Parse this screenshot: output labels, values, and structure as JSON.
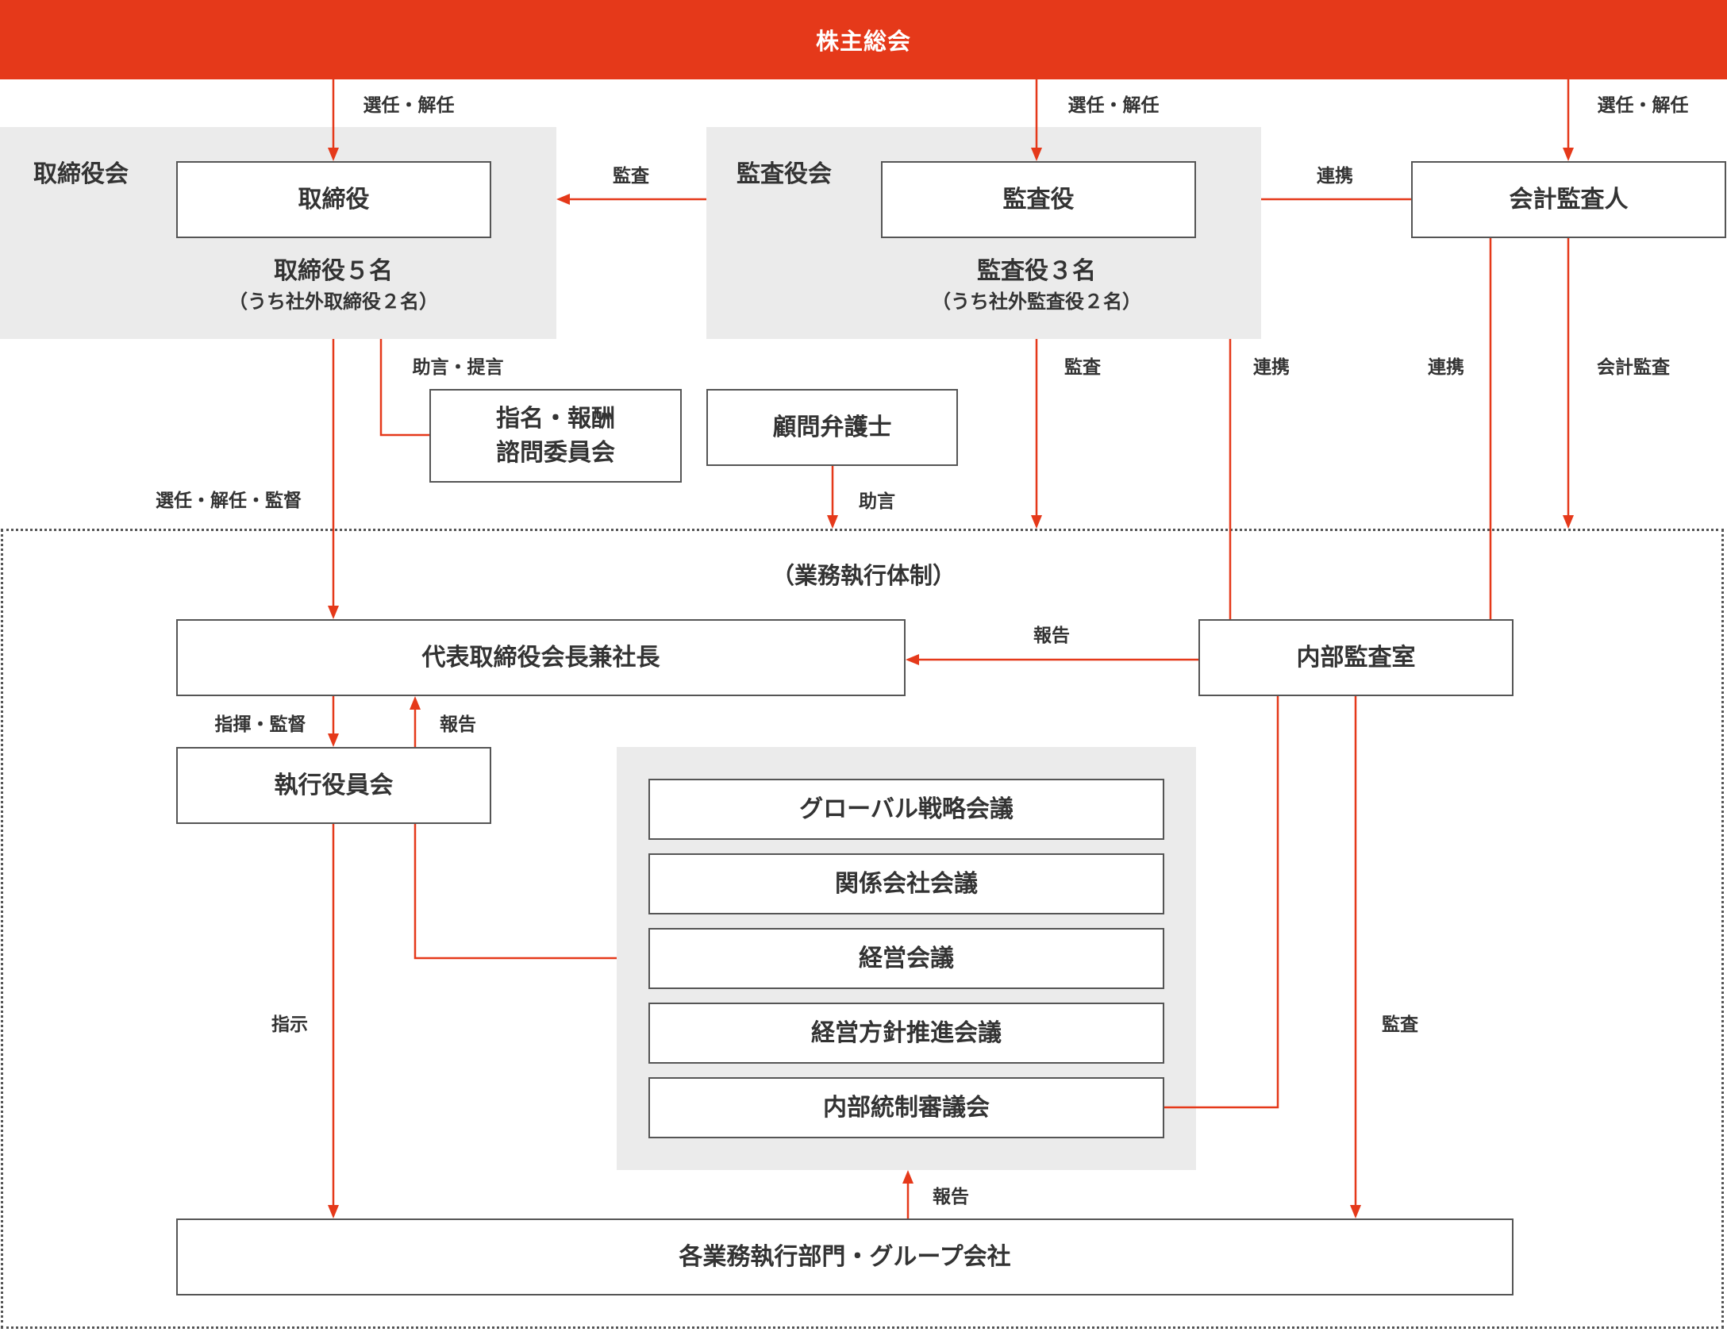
{
  "title": "株主総会",
  "colors": {
    "accent": "#e5391a",
    "box_border": "#555555",
    "group_bg": "#ebebeb",
    "text": "#333333"
  },
  "board": {
    "group_label": "取締役会",
    "box_label": "取締役",
    "count": "取締役５名",
    "count_detail": "（うち社外取締役２名）"
  },
  "audit_board": {
    "group_label": "監査役会",
    "box_label": "監査役",
    "count": "監査役３名",
    "count_detail": "（うち社外監査役２名）"
  },
  "accounting_auditor": {
    "label": "会計監査人"
  },
  "nomination_committee": {
    "line1": "指名・報酬",
    "line2": "諮問委員会"
  },
  "legal_advisor": {
    "label": "顧問弁護士"
  },
  "execution": {
    "title": "（業務執行体制）",
    "president": "代表取締役会長兼社長",
    "internal_audit": "内部監査室",
    "executive_committee": "執行役員会",
    "meetings": [
      "グローバル戦略会議",
      "関係会社会議",
      "経営会議",
      "経営方針推進会議",
      "内部統制審議会"
    ],
    "divisions": "各業務執行部門・グループ会社"
  },
  "edge_labels": {
    "elect_board": "選任・解任",
    "elect_auditor": "選任・解任",
    "elect_accounting": "選任・解任",
    "audit_board": "監査",
    "cooperate_top": "連携",
    "advice_proposal": "助言・提言",
    "elect_supervise": "選任・解任・監督",
    "advice": "助言",
    "audit_execution": "監査",
    "cooperate_internal1": "連携",
    "cooperate_internal2": "連携",
    "accounting_audit": "会計監査",
    "report_internal": "報告",
    "direct_supervise": "指揮・監督",
    "report_exec": "報告",
    "instruct": "指示",
    "audit_divisions": "監査",
    "report_divisions": "報告"
  }
}
